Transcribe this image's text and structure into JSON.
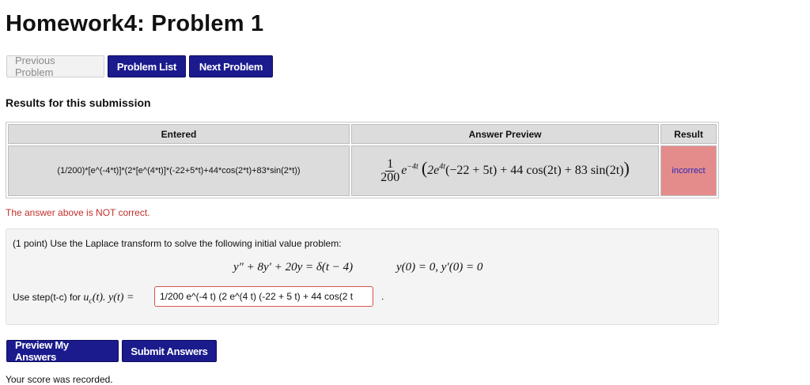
{
  "page": {
    "title": "Homework4: Problem 1"
  },
  "nav": {
    "previous": "Previous Problem",
    "list": "Problem List",
    "next": "Next Problem"
  },
  "results": {
    "heading": "Results for this submission",
    "columns": [
      "Entered",
      "Answer Preview",
      "Result"
    ],
    "row": {
      "entered": "(1/200)*[e^(-4*t)]*(2*[e^(4*t)]*(-22+5*t)+44*cos(2*t)+83*sin(2*t))",
      "preview_num": "1",
      "preview_den": "200",
      "preview_exp1": "e",
      "preview_sup1": "−4t",
      "preview_open": "(",
      "preview_body1": "2e",
      "preview_sup2": "4t",
      "preview_body2": "(−22 + 5t) + 44 cos(2t) + 83 sin(2t)",
      "preview_close": ")",
      "result": "incorrect"
    },
    "message": "The answer above is NOT correct."
  },
  "problem": {
    "intro": "(1 point) Use the Laplace transform to solve the following initial value problem:",
    "equation": "y″ + 8y′ + 20y = δ(t − 4)",
    "initial": "y(0) = 0,  y′(0) = 0",
    "instruction_prefix": "Use step(t-c) for ",
    "instruction_math": "u",
    "instruction_sub": "c",
    "instruction_math2": "(t). y(t) = ",
    "answer_value": "1/200 e^(-4 t) (2 e^(4 t) (-22 + 5 t) + 44 cos(2 t",
    "period": "."
  },
  "actions": {
    "preview": "Preview My Answers",
    "submit": "Submit Answers"
  },
  "footer": {
    "score": "Your score was recorded."
  },
  "colors": {
    "primary_button": "#1b1b8e",
    "incorrect_bg": "#e48b8b",
    "error_text": "#c0302c"
  }
}
